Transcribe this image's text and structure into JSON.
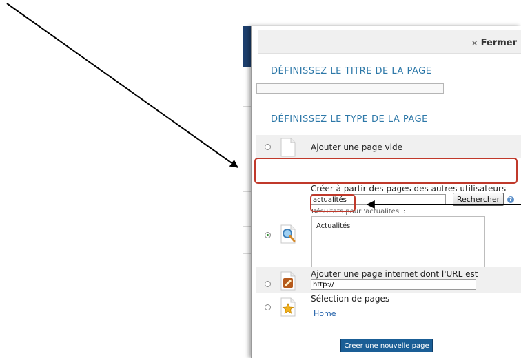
{
  "modal": {
    "close_label": "Fermer",
    "title_section": "DÉFINISSEZ LE TITRE DE LA PAGE",
    "title_input_value": "",
    "type_section": "DÉFINISSEZ LE TYPE DE LA PAGE",
    "options": {
      "blank": {
        "label": "Ajouter une page vide",
        "selected": false,
        "icon": "blank-page-icon"
      },
      "from_users": {
        "label": "Créer à partir des pages des autres utilisateurs",
        "selected": true,
        "icon": "magnifier-page-icon",
        "search_value": "actualités",
        "search_button": "Rechercher",
        "results_label": "Résultats pour 'actualites' :",
        "results": [
          "Actualités"
        ]
      },
      "url": {
        "label": "Ajouter une page internet dont l'URL est",
        "selected": false,
        "url_value": "http://",
        "icon": "pencil-page-icon"
      },
      "selection": {
        "label": "Sélection de pages",
        "selected": false,
        "link": "Home",
        "icon": "star-page-icon"
      }
    },
    "create_button": "Creer une nouvelle page"
  },
  "colors": {
    "section_title": "#2d78a8",
    "highlight": "#c0392b",
    "primary_button": "#1a5e96"
  }
}
